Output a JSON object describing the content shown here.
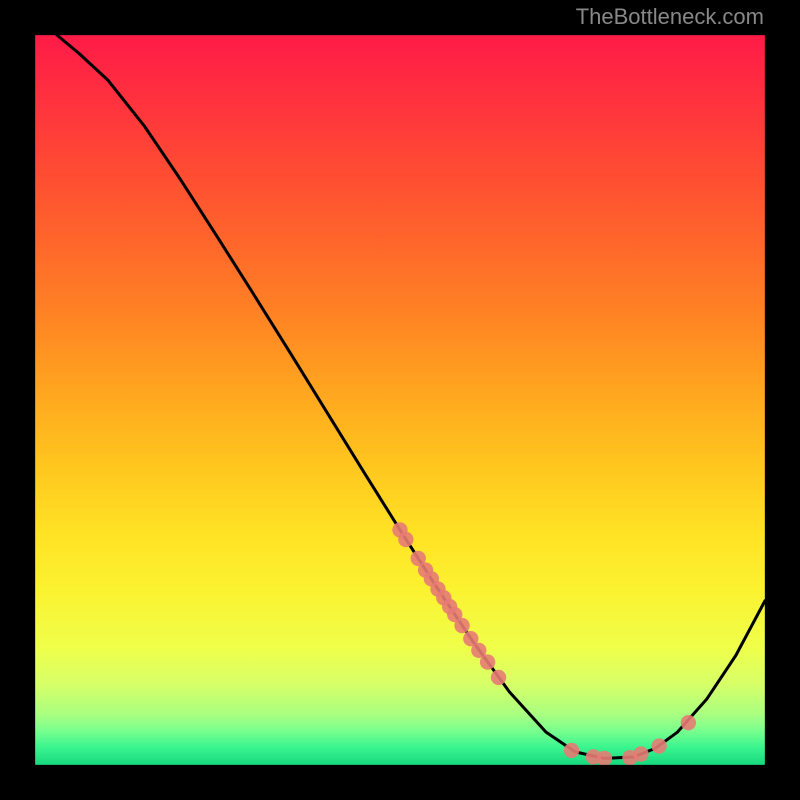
{
  "attribution": "TheBottleneck.com",
  "colors": {
    "bg": "#000000",
    "border": "#000000",
    "curve": "#000000",
    "point_fill": "#e77b74",
    "point_stroke": "#e77b74",
    "gradient_stops": [
      {
        "offset": 0.0,
        "color": "#ff1b47"
      },
      {
        "offset": 0.08,
        "color": "#ff2f3f"
      },
      {
        "offset": 0.18,
        "color": "#ff4a34"
      },
      {
        "offset": 0.28,
        "color": "#ff652b"
      },
      {
        "offset": 0.38,
        "color": "#ff8224"
      },
      {
        "offset": 0.48,
        "color": "#ffa31f"
      },
      {
        "offset": 0.58,
        "color": "#ffc31e"
      },
      {
        "offset": 0.68,
        "color": "#ffe224"
      },
      {
        "offset": 0.76,
        "color": "#fbf230"
      },
      {
        "offset": 0.84,
        "color": "#efff4a"
      },
      {
        "offset": 0.89,
        "color": "#d6ff68"
      },
      {
        "offset": 0.93,
        "color": "#aaff80"
      },
      {
        "offset": 0.955,
        "color": "#74ff8e"
      },
      {
        "offset": 0.975,
        "color": "#3cf58f"
      },
      {
        "offset": 1.0,
        "color": "#17d97f"
      }
    ]
  },
  "chart_data": {
    "type": "line",
    "title": "",
    "xlabel": "",
    "ylabel": "",
    "xlim": [
      0,
      100
    ],
    "ylim": [
      0,
      100
    ],
    "grid": false,
    "curve": [
      {
        "x": 3.0,
        "y": 100.0
      },
      {
        "x": 6.0,
        "y": 97.5
      },
      {
        "x": 10.0,
        "y": 93.8
      },
      {
        "x": 15.0,
        "y": 87.5
      },
      {
        "x": 20.0,
        "y": 80.1
      },
      {
        "x": 25.0,
        "y": 72.3
      },
      {
        "x": 30.0,
        "y": 64.4
      },
      {
        "x": 35.0,
        "y": 56.4
      },
      {
        "x": 40.0,
        "y": 48.3
      },
      {
        "x": 45.0,
        "y": 40.2
      },
      {
        "x": 50.0,
        "y": 32.2
      },
      {
        "x": 55.0,
        "y": 24.4
      },
      {
        "x": 60.0,
        "y": 16.9
      },
      {
        "x": 65.0,
        "y": 10.0
      },
      {
        "x": 70.0,
        "y": 4.5
      },
      {
        "x": 74.0,
        "y": 1.8
      },
      {
        "x": 78.0,
        "y": 0.9
      },
      {
        "x": 82.0,
        "y": 1.1
      },
      {
        "x": 85.0,
        "y": 2.3
      },
      {
        "x": 88.0,
        "y": 4.5
      },
      {
        "x": 92.0,
        "y": 9.0
      },
      {
        "x": 96.0,
        "y": 15.0
      },
      {
        "x": 100.0,
        "y": 22.5
      }
    ],
    "series": [
      {
        "name": "points",
        "type": "scatter",
        "values": [
          {
            "x": 50.0,
            "y": 32.2
          },
          {
            "x": 50.8,
            "y": 30.9
          },
          {
            "x": 52.5,
            "y": 28.3
          },
          {
            "x": 53.5,
            "y": 26.7
          },
          {
            "x": 54.3,
            "y": 25.5
          },
          {
            "x": 55.2,
            "y": 24.1
          },
          {
            "x": 56.0,
            "y": 22.9
          },
          {
            "x": 56.8,
            "y": 21.7
          },
          {
            "x": 57.5,
            "y": 20.6
          },
          {
            "x": 58.5,
            "y": 19.1
          },
          {
            "x": 59.7,
            "y": 17.3
          },
          {
            "x": 60.8,
            "y": 15.7
          },
          {
            "x": 62.0,
            "y": 14.1
          },
          {
            "x": 63.5,
            "y": 12.0
          },
          {
            "x": 73.5,
            "y": 2.0
          },
          {
            "x": 76.5,
            "y": 1.1
          },
          {
            "x": 78.0,
            "y": 0.9
          },
          {
            "x": 81.5,
            "y": 1.0
          },
          {
            "x": 83.0,
            "y": 1.5
          },
          {
            "x": 85.5,
            "y": 2.6
          },
          {
            "x": 89.5,
            "y": 5.8
          }
        ]
      }
    ]
  }
}
